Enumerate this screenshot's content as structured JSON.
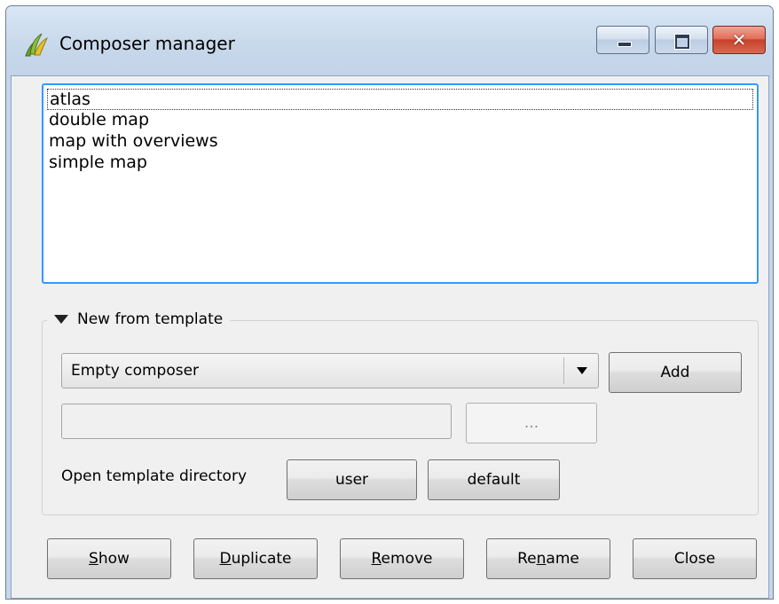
{
  "window": {
    "title": "Composer manager"
  },
  "composer_list": {
    "items": [
      "atlas",
      "double map",
      "map with overviews",
      "simple map"
    ],
    "focused_index": 0
  },
  "template_group": {
    "title": "New from template",
    "expanded": true,
    "template_select": {
      "selected": "Empty composer"
    },
    "add_label": "Add",
    "path_value": "",
    "browse_label": "...",
    "open_dir_label": "Open template directory",
    "user_label": "user",
    "default_label": "default"
  },
  "footer": {
    "show": {
      "pre": "",
      "key": "S",
      "post": "how"
    },
    "duplicate": {
      "pre": "",
      "key": "D",
      "post": "uplicate"
    },
    "remove": {
      "pre": "",
      "key": "R",
      "post": "emove"
    },
    "rename": {
      "pre": "Re",
      "key": "n",
      "post": "ame"
    },
    "close_label": "Close"
  },
  "colors": {
    "focus_border": "#3399ff",
    "close_button": "#c9412a",
    "title_bar": "#c6d7ea"
  },
  "icons": [
    "qgis-logo-icon",
    "minimize-icon",
    "maximize-icon",
    "close-icon",
    "expand-triangle-icon",
    "dropdown-arrow-icon"
  ]
}
